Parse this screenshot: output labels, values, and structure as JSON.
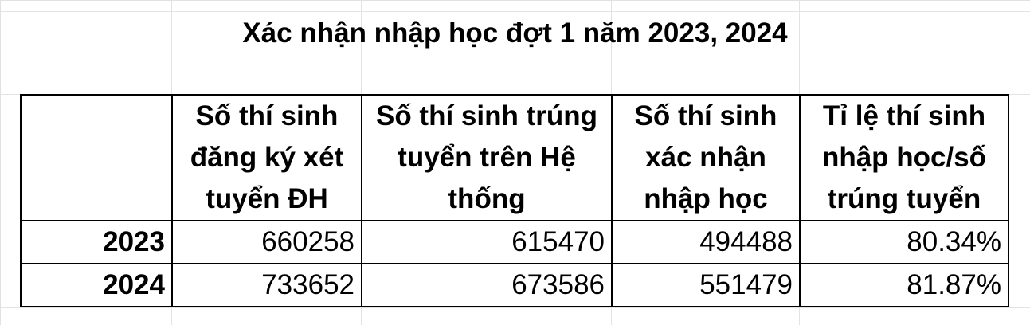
{
  "title": "Xác nhận nhập học đợt 1 năm 2023, 2024",
  "table": {
    "headers": [
      "",
      "Số thí sinh đăng ký xét tuyển ĐH",
      "Số thí sinh trúng tuyển trên Hệ thống",
      "Số thí sinh xác nhận nhập học",
      "Tỉ lệ thí sinh nhập học/số trúng tuyển"
    ],
    "rows": [
      {
        "year": "2023",
        "registered": "660258",
        "admitted": "615470",
        "confirmed": "494488",
        "rate": "80.34%"
      },
      {
        "year": "2024",
        "registered": "733652",
        "admitted": "673586",
        "confirmed": "551479",
        "rate": "81.87%"
      }
    ]
  }
}
